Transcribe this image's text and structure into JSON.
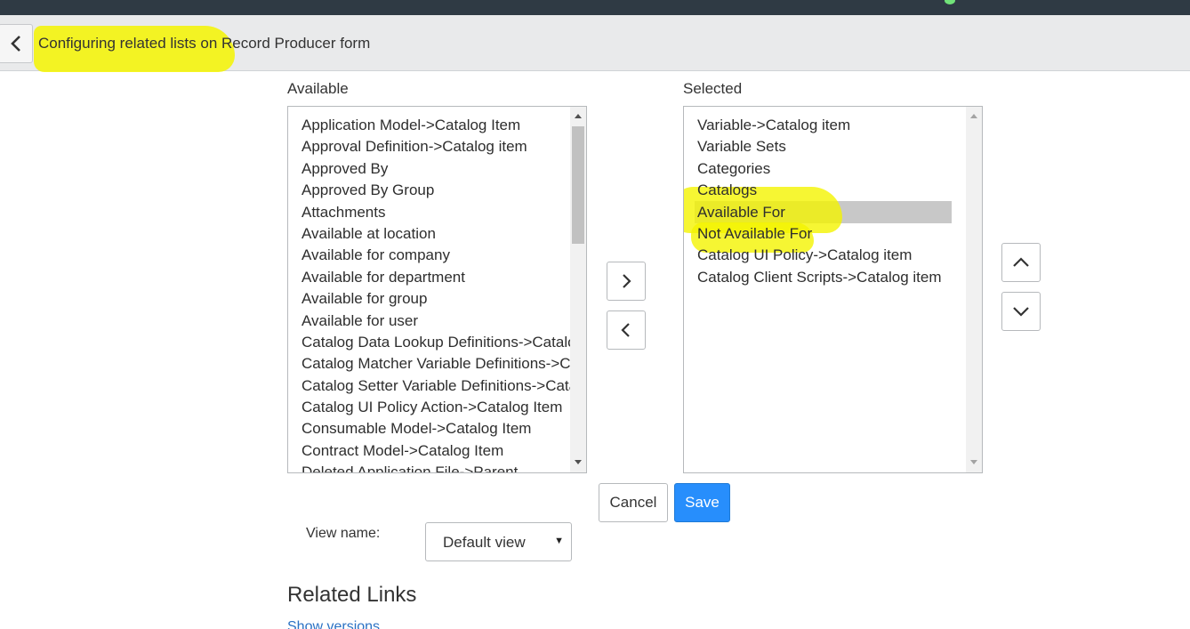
{
  "header": {
    "title": "Configuring related lists on Record Producer form",
    "back_icon": "chevron-left-icon"
  },
  "available": {
    "label": "Available",
    "items": [
      "Application Model->Catalog Item",
      "Approval Definition->Catalog item",
      "Approved By",
      "Approved By Group",
      "Attachments",
      "Available at location",
      "Available for company",
      "Available for department",
      "Available for group",
      "Available for user",
      "Catalog Data Lookup Definitions->Catalog Item",
      "Catalog Matcher Variable Definitions->Catalog Item",
      "Catalog Setter Variable Definitions->Catalog Item",
      "Catalog UI Policy Action->Catalog Item",
      "Consumable Model->Catalog Item",
      "Contract Model->Catalog Item",
      "Deleted Application File->Parent"
    ]
  },
  "selected": {
    "label": "Selected",
    "selected_item": "Available For",
    "items": [
      "Variable->Catalog item",
      "Variable Sets",
      "Categories",
      "Catalogs",
      "Available For",
      "Not Available For",
      "Catalog UI Policy->Catalog item",
      "Catalog Client Scripts->Catalog item"
    ]
  },
  "transfer": {
    "add_icon": "chevron-right-icon",
    "remove_icon": "chevron-left-icon"
  },
  "order": {
    "up_icon": "chevron-up-icon",
    "down_icon": "chevron-down-icon"
  },
  "actions": {
    "cancel_label": "Cancel",
    "save_label": "Save"
  },
  "view": {
    "label": "View name:",
    "value": "Default view"
  },
  "related": {
    "title": "Related Links",
    "link": "Show versions"
  },
  "colors": {
    "highlight": "#f4f400",
    "save_button": "#278efc",
    "selected_row": "#c8c8c8",
    "topbar": "#2f3a44"
  }
}
